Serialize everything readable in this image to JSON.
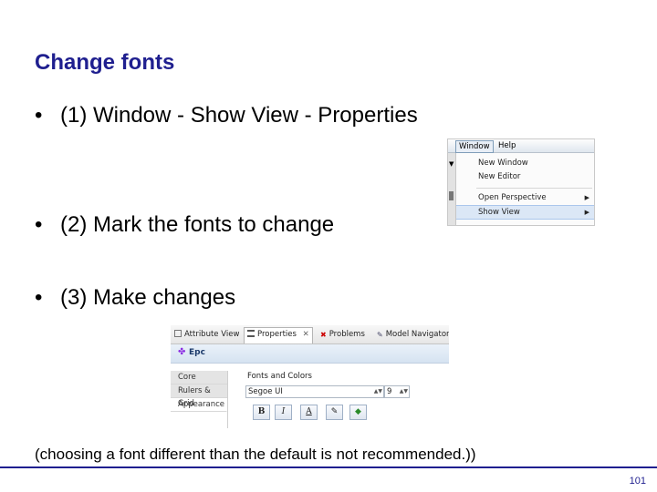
{
  "slide": {
    "title": "Change fonts",
    "bullets": [
      "(1) Window - Show View - Properties",
      "(2) Mark the fonts to change",
      "(3) Make changes"
    ],
    "bullet_glyph": "•",
    "caption": "(choosing a font different than the default is not recommended.))",
    "page_number": "101",
    "accent_color": "#1f1f8f"
  },
  "window_menu": {
    "menubar": [
      "Window",
      "Help"
    ],
    "items": [
      {
        "label": "New Window",
        "submenu": false
      },
      {
        "label": "New Editor",
        "submenu": false
      },
      {
        "label": "Open Perspective",
        "submenu": true
      },
      {
        "label": "Show View",
        "submenu": true,
        "highlighted": true
      }
    ]
  },
  "properties_view": {
    "tabs": [
      "Attribute View",
      "Properties",
      "Problems",
      "Model Navigator"
    ],
    "active_tab": "Properties",
    "title": "Epc",
    "side_tabs": [
      "Core",
      "Rulers & Grid",
      "Appearance"
    ],
    "selected_side_tab": "Appearance",
    "section_label": "Fonts and Colors",
    "font_name": "Segoe UI",
    "font_size": "9",
    "format_buttons": [
      "B",
      "I",
      "A"
    ]
  }
}
